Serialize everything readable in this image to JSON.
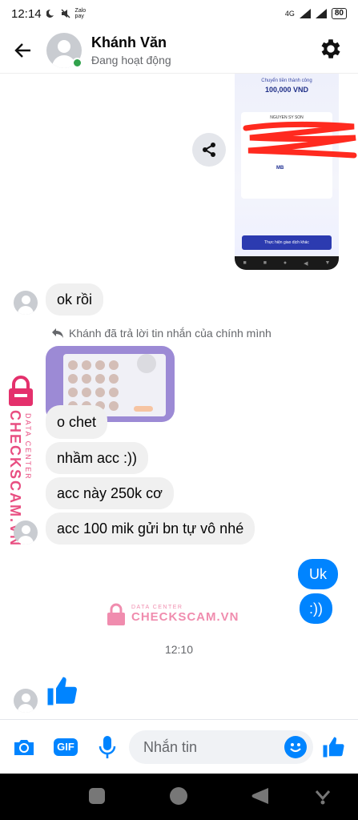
{
  "status_bar": {
    "time": "12:14",
    "left_icons": [
      "moon-icon",
      "mute-icon",
      "zalo-pay-icon"
    ],
    "zalo_pay_label": "Zalo pay",
    "network": "4G",
    "battery": "80"
  },
  "header": {
    "name": "Khánh Văn",
    "status": "Đang hoạt động",
    "online": true
  },
  "shared_image": {
    "title": "Chuyển tiền thành công",
    "amount": "100,000 VND",
    "recipient": "NGUYEN SY SON",
    "bank": "MB",
    "button": "Thực hiện giao dịch khác",
    "redaction_color": "#ff2a1f"
  },
  "messages": {
    "ok": "ok rồi",
    "reply_note": "Khánh đã trả lời tin nhắn của chính mình",
    "o_chet": "o chet",
    "nham_acc": "nhầm acc :))",
    "acc_250k": "acc này 250k cơ",
    "acc_100": "acc 100 mik gửi bn tự vô nhé",
    "uk": "Uk",
    "smile": ":))"
  },
  "watermark": {
    "side_main": "CHECKSCAM.VN",
    "side_sub": "DATA CENTER",
    "center_sub": "DATA CENTER",
    "center_main": "CHECKSCAM.VN",
    "color": "#e4306c"
  },
  "timestamp": "12:10",
  "composer": {
    "placeholder": "Nhắn tin",
    "gif_label": "GIF"
  },
  "colors": {
    "accent": "#0084ff",
    "bubble_in": "#f0f0f0",
    "online": "#31a24c"
  }
}
